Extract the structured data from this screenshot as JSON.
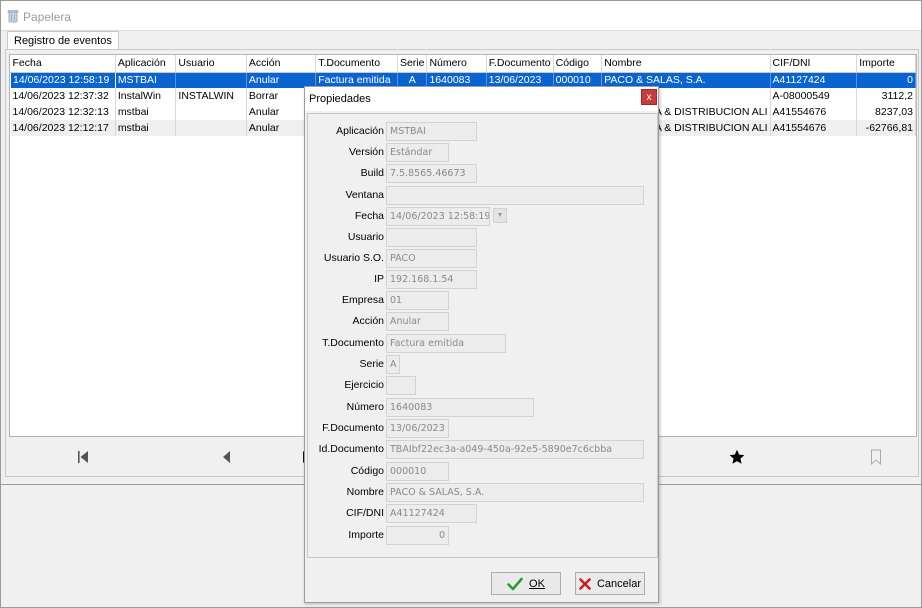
{
  "window": {
    "title": "Papelera"
  },
  "tabs": [
    {
      "label": "Registro de eventos"
    }
  ],
  "grid": {
    "columns": [
      "Fecha",
      "Aplicación",
      "Usuario",
      "Acción",
      "T.Documento",
      "Serie",
      "Número",
      "F.Documento",
      "Código",
      "Nombre",
      "CIF/DNI",
      "Importe"
    ],
    "rows": [
      {
        "fecha": "14/06/2023 12:58:19",
        "aplicacion": "MSTBAI",
        "usuario": "",
        "accion": "Anular",
        "tdocumento": "Factura emitida",
        "serie": "A",
        "numero": "1640083",
        "fdocumento": "13/06/2023",
        "codigo": "000010",
        "nombre": "PACO & SALAS, S.A.",
        "cif": "A41127424",
        "importe": "0"
      },
      {
        "fecha": "14/06/2023 12:37:32",
        "aplicacion": "InstalWin",
        "usuario": "INSTALWIN",
        "accion": "Borrar",
        "tdocumento": "",
        "serie": "",
        "numero": "",
        "fdocumento": "",
        "codigo": "",
        "nombre": "",
        "cif": "A-08000549",
        "importe": "3112,2"
      },
      {
        "fecha": "14/06/2023 12:32:13",
        "aplicacion": "mstbai",
        "usuario": "",
        "accion": "Anular",
        "tdocumento": "",
        "serie": "",
        "numero": "",
        "fdocumento": "",
        "codigo": "",
        "nombre": "A & DISTRIBUCION ALI",
        "cif": "A41554676",
        "importe": "8237,03"
      },
      {
        "fecha": "14/06/2023 12:12:17",
        "aplicacion": "mstbai",
        "usuario": "",
        "accion": "Anular",
        "tdocumento": "",
        "serie": "",
        "numero": "",
        "fdocumento": "",
        "codigo": "",
        "nombre": "A & DISTRIBUCION ALI",
        "cif": "A41554676",
        "importe": "-62766,81"
      }
    ]
  },
  "navbar": {
    "icons": [
      "first-record-icon",
      "prior-record-icon",
      "next-record-icon",
      "favorite-star-icon",
      "bookmark-icon"
    ]
  },
  "dialog": {
    "title": "Propiedades",
    "close_label": "x",
    "fields": {
      "aplicacion": {
        "label": "Aplicación",
        "value": "MSTBAI"
      },
      "version": {
        "label": "Versión",
        "value": "Estándar"
      },
      "build": {
        "label": "Build",
        "value": "7.5.8565.46673"
      },
      "ventana": {
        "label": "Ventana",
        "value": ""
      },
      "fecha": {
        "label": "Fecha",
        "value": "14/06/2023 12:58:19"
      },
      "usuario": {
        "label": "Usuario",
        "value": ""
      },
      "usuario_so": {
        "label": "Usuario S.O.",
        "value": "PACO"
      },
      "ip": {
        "label": "IP",
        "value": "192.168.1.54"
      },
      "empresa": {
        "label": "Empresa",
        "value": "01"
      },
      "accion": {
        "label": "Acción",
        "value": "Anular"
      },
      "tdocumento": {
        "label": "T.Documento",
        "value": "Factura emitida"
      },
      "serie": {
        "label": "Serie",
        "value": "A"
      },
      "ejercicio": {
        "label": "Ejercicio",
        "value": ""
      },
      "numero": {
        "label": "Número",
        "value": "1640083"
      },
      "fdocumento": {
        "label": "F.Documento",
        "value": "13/06/2023"
      },
      "iddocumento": {
        "label": "Id.Documento",
        "value": "TBAIbf22ec3a-a049-450a-92e5-5890e7c6cbba"
      },
      "codigo": {
        "label": "Código",
        "value": "000010"
      },
      "nombre": {
        "label": "Nombre",
        "value": "PACO & SALAS, S.A."
      },
      "cif": {
        "label": "CIF/DNI",
        "value": "A41127424"
      },
      "importe": {
        "label": "Importe",
        "value": "0"
      }
    },
    "buttons": {
      "ok_label": "OK",
      "cancel_label": "Cancelar"
    }
  },
  "colors": {
    "selection": "#0a64d0",
    "ok_icon": "#2e9b2e",
    "cancel_icon": "#c81e1e"
  }
}
